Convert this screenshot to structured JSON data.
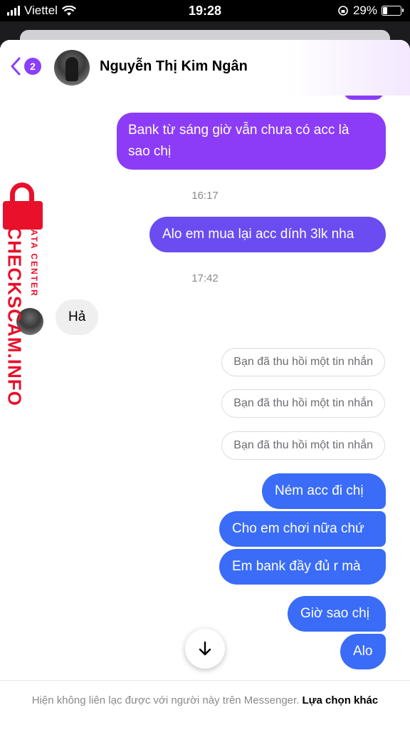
{
  "status_bar": {
    "carrier": "Viettel",
    "time": "19:28",
    "battery": "29%"
  },
  "header": {
    "back_count": "2",
    "contact_name": "Nguyễn Thị Kim Ngân"
  },
  "messages": {
    "m1": "Bank từ sáng giờ vẫn chưa có acc là sao chị",
    "time1": "16:17",
    "m2": "Alo em mua lại acc dính 3lk nha",
    "time2": "17:42",
    "incoming1": "Hả",
    "recalled1": "Bạn đã thu hồi một tin nhắn",
    "recalled2": "Bạn đã thu hồi một tin nhắn",
    "recalled3": "Bạn đã thu hồi một tin nhắn",
    "m3": "Ném acc đi chị",
    "m4": "Cho em chơi nữa chứ",
    "m5": "Em bank đầy đủ r mà",
    "m6": "Giờ sao chị",
    "m7": "Alo"
  },
  "footer": {
    "notice": "Hiện không liên lạc được với người này trên Messenger.",
    "action": "Lựa chọn khác"
  },
  "watermark": {
    "main": "CHECKSCAM.INFO",
    "sub": "DATA CENTER"
  },
  "colors": {
    "accent_purple": "#8c3cf6",
    "bubble_blue": "#3a6cf7",
    "watermark_red": "#e8102a"
  }
}
